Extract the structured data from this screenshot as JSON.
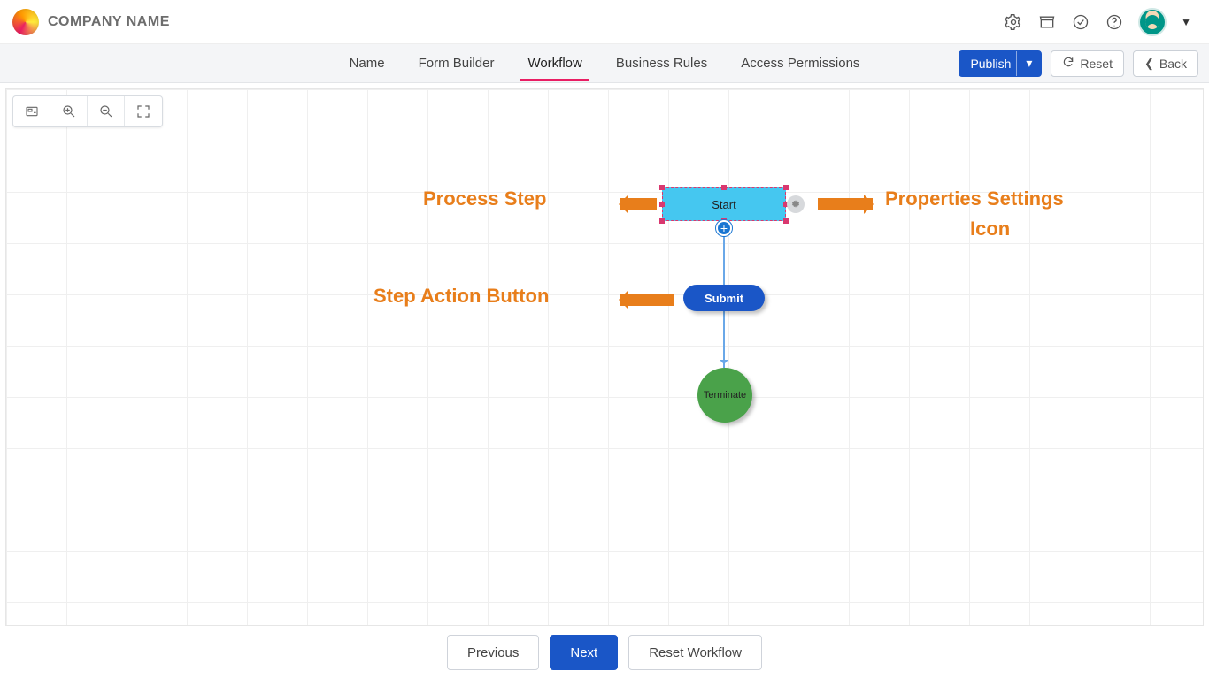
{
  "brand": {
    "name": "COMPANY NAME"
  },
  "header_icons": [
    "gear-icon",
    "store-icon",
    "check-circle-icon",
    "help-icon"
  ],
  "tabs": [
    {
      "label": "Name",
      "active": false
    },
    {
      "label": "Form Builder",
      "active": false
    },
    {
      "label": "Workflow",
      "active": true
    },
    {
      "label": "Business Rules",
      "active": false
    },
    {
      "label": "Access Permissions",
      "active": false
    }
  ],
  "actions": {
    "publish": "Publish",
    "reset": "Reset",
    "back": "Back"
  },
  "mini_toolbar": [
    "fit-view-icon",
    "zoom-in-icon",
    "zoom-out-icon",
    "fullscreen-icon"
  ],
  "workflow": {
    "start_label": "Start",
    "submit_label": "Submit",
    "terminate_label": "Terminate"
  },
  "annotations": {
    "process_step": "Process Step",
    "properties_icon": "Properties Settings Icon",
    "step_action_button": "Step Action Button"
  },
  "footer": {
    "previous": "Previous",
    "next": "Next",
    "reset_workflow": "Reset Workflow"
  }
}
